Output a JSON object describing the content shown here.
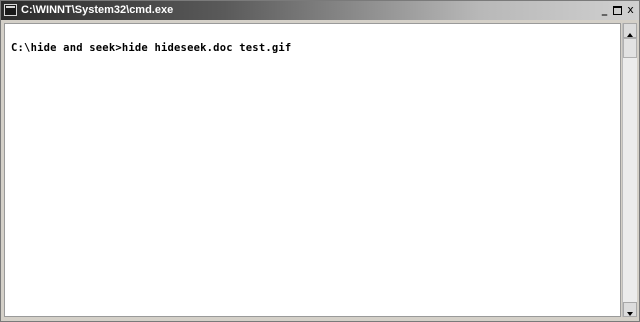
{
  "window": {
    "title": "C:\\WINNT\\System32\\cmd.exe",
    "icon": "console-app-icon"
  },
  "caption_buttons": {
    "minimize_icon": "minimize-icon",
    "maximize_icon": "maximize-icon",
    "close_label": "x"
  },
  "console": {
    "line1": "C:\\hide and seek>hide hideseek.doc test.gif"
  },
  "scrollbar": {
    "up_icon": "arrow-up-icon",
    "down_icon": "arrow-down-icon"
  },
  "colors": {
    "console_background": "#ffffff",
    "console_text": "#000000",
    "titlebar_text": "#ffffff"
  }
}
